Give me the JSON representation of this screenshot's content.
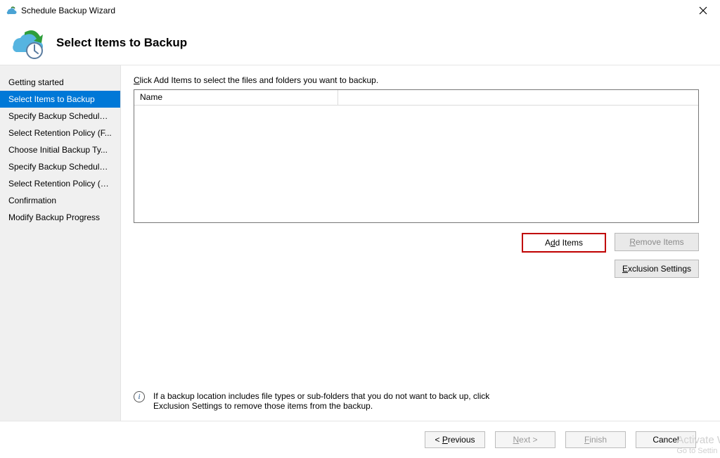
{
  "window": {
    "title": "Schedule Backup Wizard"
  },
  "header": {
    "page_title": "Select Items to Backup"
  },
  "sidebar": {
    "items": [
      {
        "label": "Getting started",
        "selected": false
      },
      {
        "label": "Select Items to Backup",
        "selected": true
      },
      {
        "label": "Specify Backup Schedule ...",
        "selected": false
      },
      {
        "label": "Select Retention Policy (F...",
        "selected": false
      },
      {
        "label": "Choose Initial Backup Ty...",
        "selected": false
      },
      {
        "label": "Specify Backup Schedule ...",
        "selected": false
      },
      {
        "label": "Select Retention Policy (S...",
        "selected": false
      },
      {
        "label": "Confirmation",
        "selected": false
      },
      {
        "label": "Modify Backup Progress",
        "selected": false
      }
    ]
  },
  "main": {
    "instruction": "Click Add Items to select the files and folders you want to backup.",
    "columns": {
      "name": "Name"
    },
    "buttons": {
      "add_items": "Add Items",
      "remove_items": "Remove Items",
      "exclusion_settings": "Exclusion Settings"
    },
    "info_text": "If a backup location includes file types or sub-folders that you do not want to back up, click Exclusion Settings to remove those items from the backup."
  },
  "footer": {
    "previous": "< Previous",
    "next": "Next >",
    "finish": "Finish",
    "cancel": "Cancel"
  },
  "watermark": {
    "line1": "Activate W",
    "line2": "Go to Settin"
  }
}
